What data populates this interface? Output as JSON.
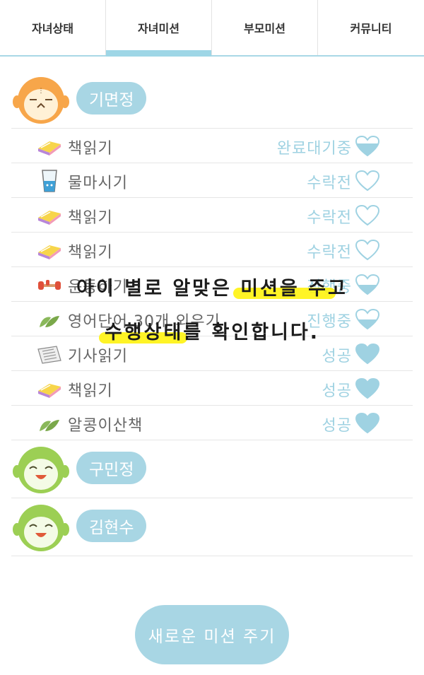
{
  "tabs": [
    {
      "label": "자녀상태"
    },
    {
      "label": "자녀미션",
      "active": true
    },
    {
      "label": "부모미션"
    },
    {
      "label": "커뮤니티"
    }
  ],
  "children": [
    {
      "name": "기면정",
      "avatar_color": "#f7a64a",
      "missions": [
        {
          "title": "책읽기",
          "icon": "book-icon",
          "status": "완료대기중",
          "heart": "half"
        },
        {
          "title": "물마시기",
          "icon": "water-cup-icon",
          "status": "수락전",
          "heart": "empty"
        },
        {
          "title": "책읽기",
          "icon": "book-icon",
          "status": "수락전",
          "heart": "empty"
        },
        {
          "title": "책읽기",
          "icon": "book-icon",
          "status": "수락전",
          "heart": "empty"
        },
        {
          "title": "운동하기",
          "icon": "dumbbell-icon",
          "status": "진행중",
          "heart": "half"
        },
        {
          "title": "영어단어 30개 외우기",
          "icon": "leaf-icon",
          "status": "진행중",
          "heart": "half"
        },
        {
          "title": "기사읽기",
          "icon": "newspaper-icon",
          "status": "성공",
          "heart": "full"
        },
        {
          "title": "책읽기",
          "icon": "book-icon",
          "status": "성공",
          "heart": "full"
        },
        {
          "title": "알콩이산책",
          "icon": "leaf-icon",
          "status": "성공",
          "heart": "full"
        }
      ]
    },
    {
      "name": "구민정",
      "avatar_color": "#9ccf54"
    },
    {
      "name": "김현수",
      "avatar_color": "#9ccf54"
    }
  ],
  "caption": {
    "line1": "아이 별로 알맞은 미션을 주고",
    "line2": "수행상태를 확인합니다."
  },
  "new_mission_button": "새로운 미션 주기",
  "colors": {
    "accent": "#a8d6e4",
    "status_text": "#9fd2e2",
    "highlight": "#fff200"
  }
}
